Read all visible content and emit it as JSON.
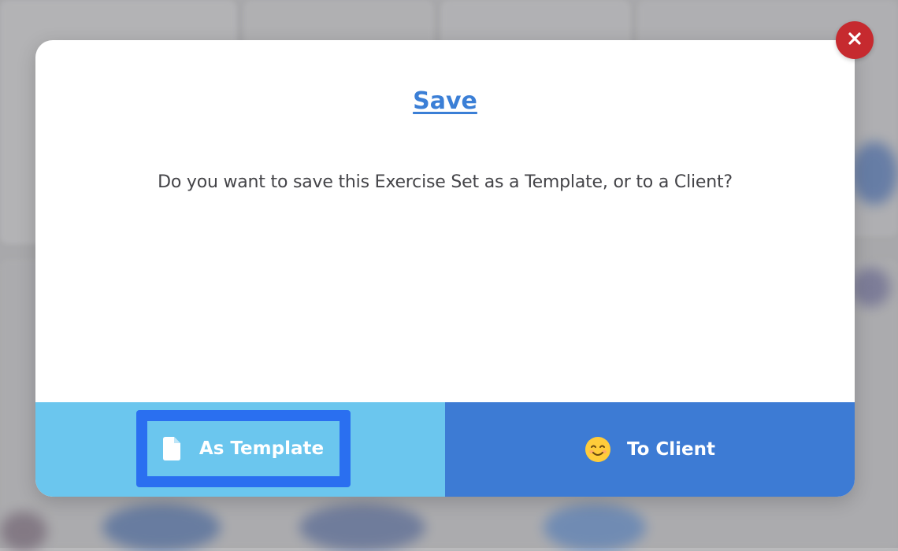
{
  "dialog": {
    "title": "Save",
    "message": "Do you want to save this Exercise Set as a Template, or to a Client?",
    "close_icon": "close-icon"
  },
  "buttons": {
    "template_label": "As Template",
    "template_icon": "document-icon",
    "client_label": "To Client",
    "client_icon": "smiling-face-icon"
  },
  "colors": {
    "title_link": "#3b7fd6",
    "left_footer": "#6bc6ee",
    "right_footer": "#3d7bd4",
    "focus_ring": "#2a6ff0",
    "close_button": "#c62a2f"
  }
}
